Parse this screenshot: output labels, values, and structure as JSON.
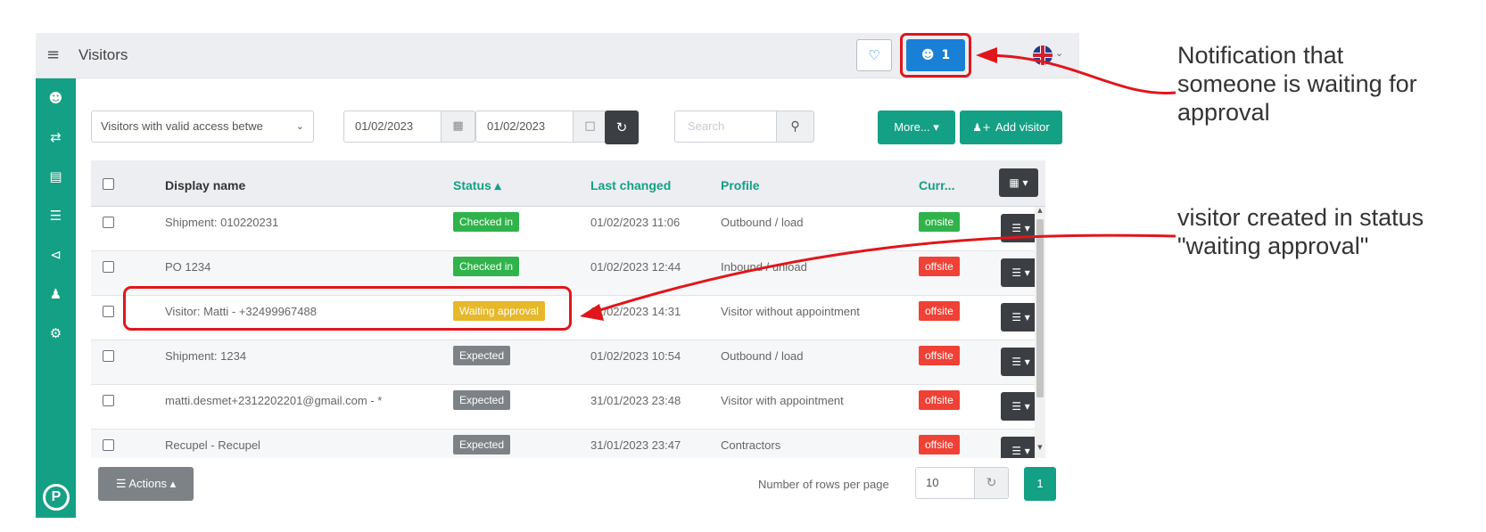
{
  "header": {
    "title": "Visitors",
    "menu_icon": "hamburger-icon",
    "visitors_waiting_count": "1",
    "bell_icon": "bell-icon",
    "visitors_icon": "users-icon",
    "language_icon": "uk-flag-icon",
    "accent_color": "#1a80d6"
  },
  "sidebar": {
    "color": "#14a085",
    "items": [
      {
        "icon": "users-icon"
      },
      {
        "icon": "exchange-icon"
      },
      {
        "icon": "truck-icon"
      },
      {
        "icon": "list-icon"
      },
      {
        "icon": "share-icon"
      },
      {
        "icon": "user-lock-icon"
      },
      {
        "icon": "gears-icon"
      }
    ],
    "logo": "P"
  },
  "toolbar": {
    "filter_label": "Visitors with valid access betwe",
    "date_from": "01/02/2023",
    "date_to": "01/02/2023",
    "search_placeholder": "Search",
    "more_label": "More... ▾",
    "add_visitor_label": "Add visitor"
  },
  "table": {
    "columns": {
      "display_name": "Display name",
      "status": "Status ▴",
      "last_changed": "Last changed",
      "profile": "Profile",
      "current": "Curr..."
    },
    "rows": [
      {
        "name": "Shipment: 010220231",
        "status": "Checked in",
        "status_color": "#2fb34a",
        "changed": "01/02/2023 11:06",
        "profile": "Outbound / load",
        "presence": "onsite",
        "presence_color": "#2fb34a"
      },
      {
        "name": "PO 1234",
        "status": "Checked in",
        "status_color": "#2fb34a",
        "changed": "01/02/2023 12:44",
        "profile": "Inbound / unload",
        "presence": "offsite",
        "presence_color": "#ef4136"
      },
      {
        "name": "Visitor: Matti - +32499967488",
        "status": "Waiting approval",
        "status_color": "#e6b82a",
        "changed": "01/02/2023 14:31",
        "profile": "Visitor without appointment",
        "presence": "offsite",
        "presence_color": "#ef4136"
      },
      {
        "name": "Shipment: 1234",
        "status": "Expected",
        "status_color": "#7d8287",
        "changed": "01/02/2023 10:54",
        "profile": "Outbound / load",
        "presence": "offsite",
        "presence_color": "#ef4136"
      },
      {
        "name": "matti.desmet+2312202201@gmail.com - *",
        "status": "Expected",
        "status_color": "#7d8287",
        "changed": "31/01/2023 23:48",
        "profile": "Visitor with appointment",
        "presence": "offsite",
        "presence_color": "#ef4136"
      },
      {
        "name": "Recupel - Recupel",
        "status": "Expected",
        "status_color": "#7d8287",
        "changed": "31/01/2023 23:47",
        "profile": "Contractors",
        "presence": "offsite",
        "presence_color": "#ef4136"
      }
    ]
  },
  "footer": {
    "actions_label": "Actions ▴",
    "rows_per_page_label": "Number of rows per page",
    "rows_per_page": "10",
    "page": "1"
  },
  "annotations": {
    "notification_note": [
      "Notification that",
      "someone is waiting for",
      "approval"
    ],
    "status_note": [
      "visitor created in status",
      "\"waiting approval\""
    ],
    "highlight_color": "#e0161c"
  }
}
